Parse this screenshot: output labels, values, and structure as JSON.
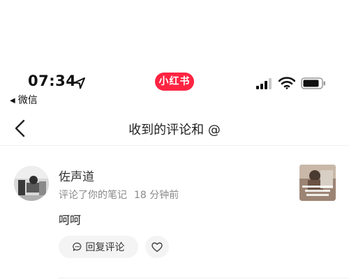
{
  "status_bar": {
    "time": "07:34",
    "back_app": "微信",
    "app_badge": "小红书"
  },
  "nav": {
    "title": "收到的评论和 @"
  },
  "comment": {
    "username": "佐声道",
    "action": "评论了你的笔记",
    "time_ago": "18 分钟前",
    "text": "呵呵",
    "reply_label": "回复评论"
  },
  "colors": {
    "brand": "#ff2442",
    "secondary_text": "#8a8a8a",
    "pill_bg": "#f4f4f4"
  }
}
